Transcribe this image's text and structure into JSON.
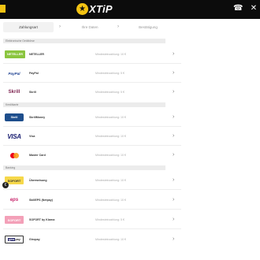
{
  "header": {
    "logo_text": "XTiP",
    "menu_icon": "menu-tab-icon",
    "phone_icon": "phone-icon",
    "close_icon": "close-icon"
  },
  "steps": [
    {
      "label": "Zahlungsart",
      "active": true
    },
    {
      "label": "Ihre Daten",
      "active": false
    },
    {
      "label": "Bestätigung",
      "active": false
    }
  ],
  "sections": [
    {
      "title": "Elektronische Geldbörse"
    },
    {
      "title": "Kreditkarte"
    },
    {
      "title": "Banking"
    }
  ],
  "payment_methods": [
    {
      "name": "NETELLER",
      "logo_text": "NETELLER",
      "min": "Mindesteinzahlung: 10 €"
    },
    {
      "name": "PayPal",
      "logo_text": "PayPal",
      "min": "Mindesteinzahlung: 5 €"
    },
    {
      "name": "Skrill",
      "logo_text": "Skrill",
      "min": "Mindesteinzahlung: 5 €"
    },
    {
      "name": "SkrillMoney",
      "logo_text": "Skrill",
      "min": "Mindesteinzahlung: 10 €"
    },
    {
      "name": "Visa",
      "logo_text": "VISA",
      "min": "Mindesteinzahlung: 10 €"
    },
    {
      "name": "Master Card",
      "logo_text": "",
      "min": "Mindesteinzahlung: 10 €"
    },
    {
      "name": "Überweisung",
      "logo_text": "SOFORT",
      "min": "Mindesteinzahlung: 10 €"
    },
    {
      "name": "SkillEPS (Netpay)",
      "logo_text": "eps",
      "min": "Mindesteinzahlung: 10 €"
    },
    {
      "name": "SOFORT by Klarna",
      "logo_text": "SOFORT",
      "min": "Mindesteinzahlung: 5 €"
    },
    {
      "name": "Giropay",
      "logo_text_left": "giro",
      "logo_text_right": "pay",
      "min": "Mindesteinzahlung: 10 €"
    }
  ],
  "colors": {
    "brand_yellow": "#f3c313",
    "topbar": "#0c0c0c",
    "section_bg": "#ececec"
  }
}
